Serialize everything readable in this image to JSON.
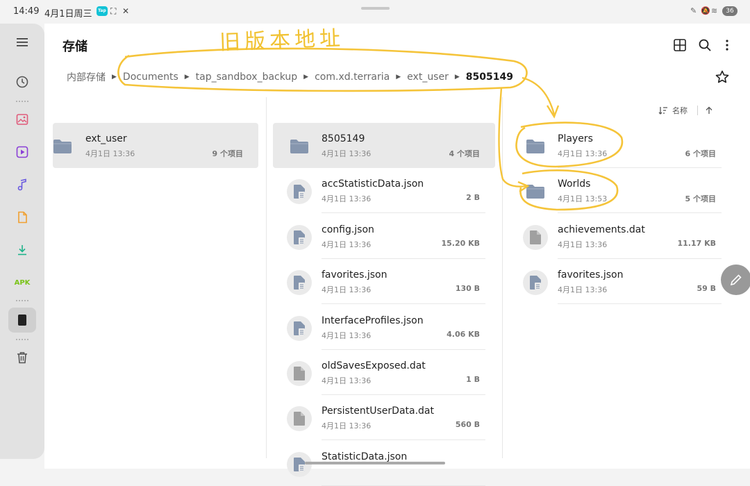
{
  "status_bar": {
    "time": "14:49",
    "date": "4月1日周三",
    "app_badge": "Tap",
    "battery": "36"
  },
  "toolbar": {
    "title": "存储"
  },
  "breadcrumb": [
    "内部存储",
    "Documents",
    "tap_sandbox_backup",
    "com.xd.terraria",
    "ext_user",
    "8505149"
  ],
  "sort": {
    "label": "名称"
  },
  "annotation": {
    "text": "旧版本地址"
  },
  "columns": [
    {
      "items": [
        {
          "type": "folder",
          "name": "ext_user",
          "date": "4月1日 13:36",
          "meta": "9 个项目",
          "selected": true
        }
      ]
    },
    {
      "items": [
        {
          "type": "folder",
          "name": "8505149",
          "date": "4月1日 13:36",
          "meta": "4 个项目",
          "selected": true
        },
        {
          "type": "doc",
          "name": "accStatisticData.json",
          "date": "4月1日 13:36",
          "meta": "2 B"
        },
        {
          "type": "doc",
          "name": "config.json",
          "date": "4月1日 13:36",
          "meta": "15.20 KB"
        },
        {
          "type": "doc",
          "name": "favorites.json",
          "date": "4月1日 13:36",
          "meta": "130 B"
        },
        {
          "type": "doc",
          "name": "InterfaceProfiles.json",
          "date": "4月1日 13:36",
          "meta": "4.06 KB"
        },
        {
          "type": "file",
          "name": "oldSavesExposed.dat",
          "date": "4月1日 13:36",
          "meta": "1 B"
        },
        {
          "type": "file",
          "name": "PersistentUserData.dat",
          "date": "4月1日 13:36",
          "meta": "560 B"
        },
        {
          "type": "doc",
          "name": "StatisticData.json",
          "date": "",
          "meta": ""
        }
      ]
    },
    {
      "items": [
        {
          "type": "folder",
          "name": "Players",
          "date": "4月1日 13:36",
          "meta": "6 个项目"
        },
        {
          "type": "folder",
          "name": "Worlds",
          "date": "4月1日 13:53",
          "meta": "5 个项目"
        },
        {
          "type": "file",
          "name": "achievements.dat",
          "date": "4月1日 13:36",
          "meta": "11.17 KB"
        },
        {
          "type": "doc",
          "name": "favorites.json",
          "date": "4月1日 13:36",
          "meta": "59 B"
        }
      ]
    }
  ]
}
